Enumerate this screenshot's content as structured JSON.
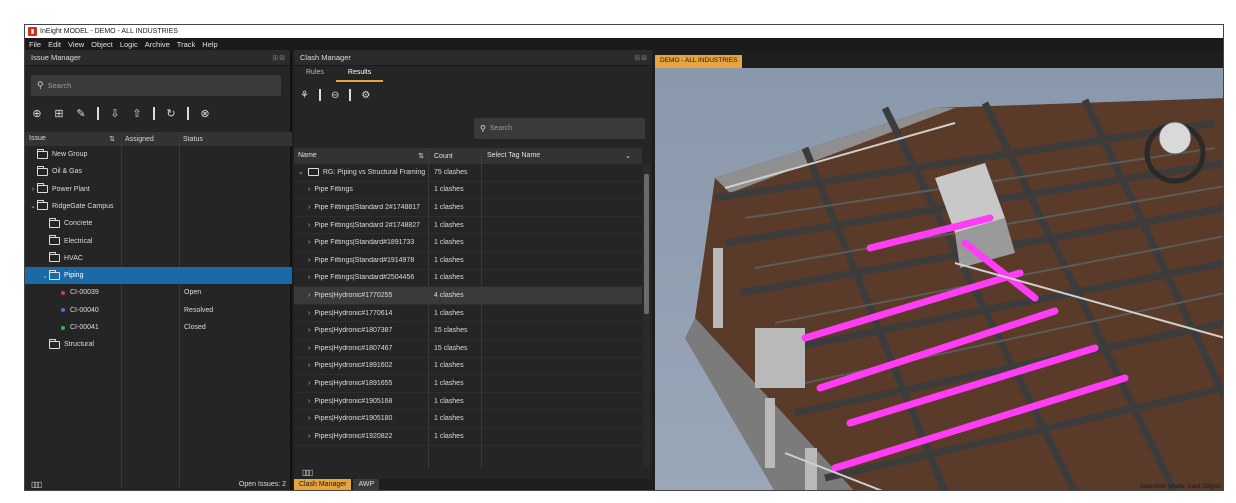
{
  "window": {
    "title": "InEight MODEL - DEMO - ALL INDUSTRIES"
  },
  "menu": [
    "File",
    "Edit",
    "View",
    "Object",
    "Logic",
    "Archive",
    "Track",
    "Help"
  ],
  "issue_manager": {
    "title": "Issue Manager",
    "search_placeholder": "Search",
    "columns": {
      "issue": "Issue",
      "assigned": "Assigned",
      "status": "Status"
    },
    "tree": [
      {
        "label": "New Group",
        "type": "folder",
        "level": 0,
        "chevron": ""
      },
      {
        "label": "Oil & Gas",
        "type": "folder",
        "level": 0,
        "chevron": ""
      },
      {
        "label": "Power Plant",
        "type": "folder",
        "level": 0,
        "chevron": ">"
      },
      {
        "label": "RidgeGate Campus",
        "type": "folder",
        "level": 0,
        "chevron": "v"
      },
      {
        "label": "Concrete",
        "type": "folder",
        "level": 1,
        "chevron": ""
      },
      {
        "label": "Electrical",
        "type": "folder",
        "level": 1,
        "chevron": ""
      },
      {
        "label": "HVAC",
        "type": "folder",
        "level": 1,
        "chevron": ""
      },
      {
        "label": "Piping",
        "type": "folder",
        "level": 1,
        "chevron": "v",
        "selected": true
      },
      {
        "label": "CI-00039",
        "type": "issue",
        "level": 2,
        "dot_color": "#e03a3a",
        "status": "Open"
      },
      {
        "label": "CI-00040",
        "type": "issue",
        "level": 2,
        "dot_color": "#3a7ae0",
        "status": "Resolved"
      },
      {
        "label": "CI-00041",
        "type": "issue",
        "level": 2,
        "dot_color": "#2fb84a",
        "status": "Closed"
      },
      {
        "label": "Structural",
        "type": "folder",
        "level": 1,
        "chevron": ""
      }
    ],
    "footer": {
      "open_issues": "Open Issues: 2"
    }
  },
  "clash_manager": {
    "title": "Clash Manager",
    "tabs": [
      "Rules",
      "Results"
    ],
    "active_tab": "Results",
    "search_placeholder": "Search",
    "columns": {
      "name": "Name",
      "count": "Count",
      "tag": "Select Tag Name"
    },
    "rows": [
      {
        "name": "RG: Piping vs Structural Framing",
        "count": "75 clashes",
        "group": true
      },
      {
        "name": "Pipe Fittings",
        "count": "1 clashes"
      },
      {
        "name": "Pipe Fittings|Standard 2#1748817",
        "count": "1 clashes"
      },
      {
        "name": "Pipe Fittings|Standard 2#1748827",
        "count": "1 clashes"
      },
      {
        "name": "Pipe Fittings|Standard#1891733",
        "count": "1 clashes"
      },
      {
        "name": "Pipe Fittings|Standard#1914978",
        "count": "1 clashes"
      },
      {
        "name": "Pipe Fittings|Standard#2504456",
        "count": "1 clashes"
      },
      {
        "name": "Pipes|Hydronic#1770255",
        "count": "4 clashes",
        "highlight": true
      },
      {
        "name": "Pipes|Hydronic#1770614",
        "count": "1 clashes"
      },
      {
        "name": "Pipes|Hydronic#1807387",
        "count": "15 clashes"
      },
      {
        "name": "Pipes|Hydronic#1807467",
        "count": "15 clashes"
      },
      {
        "name": "Pipes|Hydronic#1891602",
        "count": "1 clashes"
      },
      {
        "name": "Pipes|Hydronic#1891655",
        "count": "1 clashes"
      },
      {
        "name": "Pipes|Hydronic#1905168",
        "count": "1 clashes"
      },
      {
        "name": "Pipes|Hydronic#1905180",
        "count": "1 clashes"
      },
      {
        "name": "Pipes|Hydronic#1920822",
        "count": "1 clashes"
      }
    ],
    "bottom_tabs": [
      "Clash Manager",
      "AWP"
    ]
  },
  "viewport": {
    "tab_label": "DEMO - ALL INDUSTRIES",
    "selection_mode": "Selection Mode: Last Object"
  },
  "colors": {
    "accent": "#e6a33e",
    "selection": "#1b6aa8",
    "clash": "#ff3df5"
  }
}
